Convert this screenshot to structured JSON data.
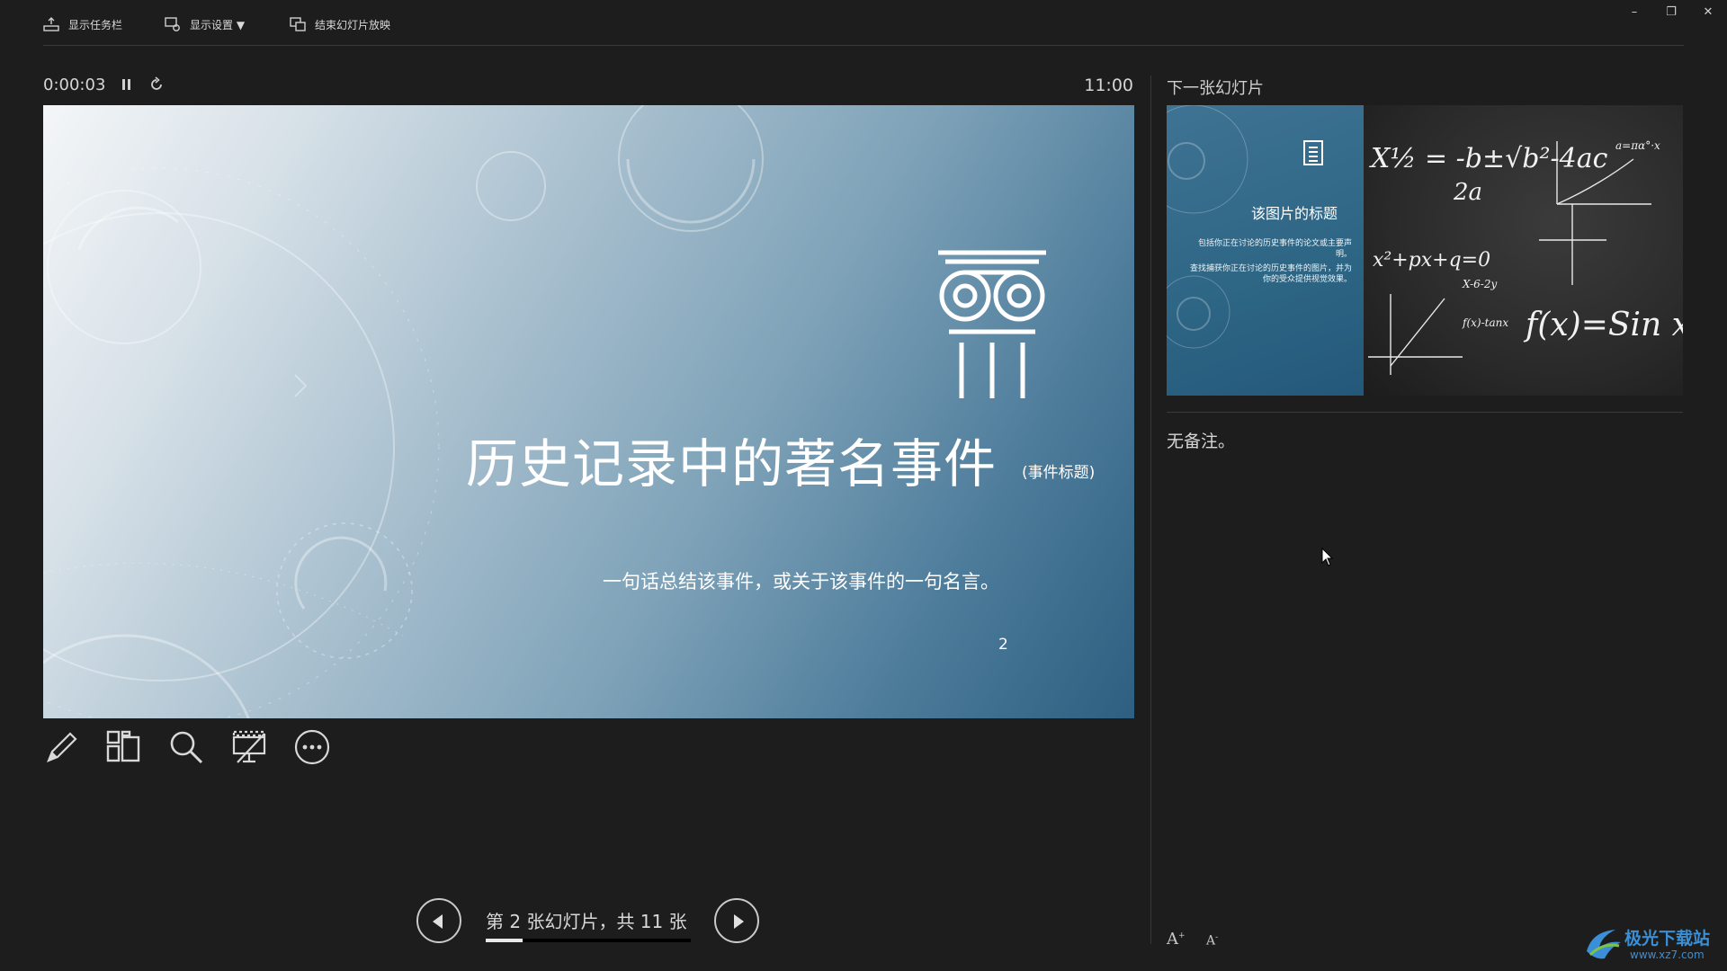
{
  "toolbar": {
    "show_taskbar": "显示任务栏",
    "display_settings": "显示设置 ▼",
    "end_slideshow": "结束幻灯片放映"
  },
  "window_controls": {
    "minimize": "–",
    "restore": "❐",
    "close": "✕"
  },
  "presenter": {
    "elapsed_time": "0:00:03",
    "clock": "11:00"
  },
  "current_slide": {
    "title": "历史记录中的著名事件",
    "title_suffix": "(事件标题)",
    "subtitle": "一句话总结该事件，或关于该事件的一句名言。",
    "page_number": "2"
  },
  "navigation": {
    "counter": "第 2 张幻灯片，共 11 张",
    "current": 2,
    "total": 11,
    "progress_fraction": 0.18
  },
  "next_slide": {
    "label": "下一张幻灯片",
    "title": "该图片的标题",
    "body1": "包括你正在讨论的历史事件的论文或主要声明。",
    "body2": "查找捕获你正在讨论的历史事件的图片，并为你的受众提供视觉效果。",
    "chalk_formula1": "X½ = -b±√b²-4ac",
    "chalk_formula1_den": "2a",
    "chalk_formula2": "x²+px+q=0",
    "chalk_formula3": "f(x)=Sin x",
    "chalk_small1": "X-6-2y",
    "chalk_small2": "f(x)-tanx",
    "chalk_small3": "a=πα°·x"
  },
  "notes": {
    "text": "无备注。"
  },
  "font_controls": {
    "increase": "A",
    "decrease": "A"
  },
  "watermark": {
    "brand": "极光下载站",
    "url": "www.xz7.com"
  },
  "colors": {
    "background": "#1d1d1d",
    "slide_accent": "#2e5f80",
    "watermark": "#3a8fd6"
  },
  "icons": [
    "taskbar-icon",
    "display-settings-icon",
    "end-show-icon",
    "pause-icon",
    "restart-icon",
    "pen-icon",
    "slides-grid-icon",
    "zoom-icon",
    "screen-toggle-icon",
    "more-icon"
  ]
}
